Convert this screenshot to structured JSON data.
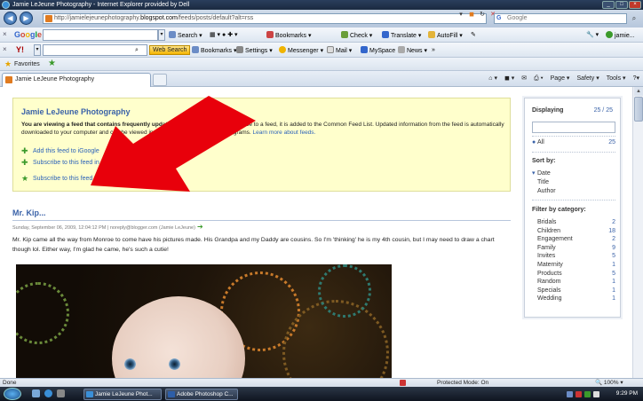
{
  "window": {
    "title": "Jamie LeJeune Photography - Internet Explorer provided by Dell"
  },
  "addressbar": {
    "url_prefix": "http://jamielejeunephotography.",
    "url_domain": "blogspot.com",
    "url_suffix": "/feeds/posts/default?alt=rss",
    "search_placeholder": "Google"
  },
  "google_toolbar": {
    "logo": "Google",
    "search_label": "Search",
    "bookmarks": "Bookmarks",
    "check": "Check",
    "translate": "Translate",
    "autofill": "AutoFill",
    "user": "jamie..."
  },
  "yahoo_toolbar": {
    "logo": "Y!",
    "web_search": "Web Search",
    "bookmarks": "Bookmarks",
    "settings": "Settings",
    "messenger": "Messenger",
    "mail": "Mail",
    "myspace": "MySpace",
    "news": "News"
  },
  "favorites": {
    "label": "Favorites"
  },
  "tab": {
    "title": "Jamie LeJeune Photography"
  },
  "command_bar": {
    "page": "Page",
    "safety": "Safety",
    "tools": "Tools"
  },
  "feed_banner": {
    "title": "Jamie LeJeune Photography",
    "bold_msg": "You are viewing a feed that contains frequently updated content.",
    "msg": " When you subscribe to a feed, it is added to the Common Feed List. Updated information from the feed is automatically downloaded to your computer and can be viewed in Internet Explorer and other programs.",
    "learn_more": "Learn more about feeds.",
    "links": [
      "Add this feed to iGoogle",
      "Subscribe to this feed in Google",
      "Subscribe to this feed"
    ]
  },
  "post": {
    "title": "Mr. Kip...",
    "meta": "Sunday, September 06, 2009, 12:04:12 PM | noreply@blogger.com (Jamie LeJeune)",
    "body": "Mr. Kip came all the way from Monroe to come have his pictures made. His Grandpa and my Daddy are cousins. So I'm 'thinking' he is my 4th cousin, but I may need to draw a chart though lol. Either way, I'm glad he came, he's such a cutie!"
  },
  "sidebar": {
    "displaying_label": "Displaying",
    "displaying_count": "25 / 25",
    "all_label": "All",
    "all_count": "25",
    "sort_label": "Sort by:",
    "sort_options": [
      "Date",
      "Title",
      "Author"
    ],
    "filter_label": "Filter by category:",
    "categories": [
      {
        "name": "Bridals",
        "count": "2"
      },
      {
        "name": "Children",
        "count": "18"
      },
      {
        "name": "Engagement",
        "count": "2"
      },
      {
        "name": "Family",
        "count": "9"
      },
      {
        "name": "Invites",
        "count": "5"
      },
      {
        "name": "Maternity",
        "count": "1"
      },
      {
        "name": "Products",
        "count": "5"
      },
      {
        "name": "Random",
        "count": "1"
      },
      {
        "name": "Specials",
        "count": "1"
      },
      {
        "name": "Wedding",
        "count": "1"
      }
    ]
  },
  "statusbar": {
    "done": "Done",
    "protected_mode": "Protected Mode: On",
    "zoom": "100%"
  },
  "taskbar": {
    "task1": "Jamie LeJeune Phot...",
    "task2": "Adobe Photoshop C...",
    "time": "9:29 PM"
  },
  "colors": {
    "link_blue": "#2b62b9",
    "title_blue": "#3a62a8",
    "banner_bg": "#ffffcc",
    "arrow_red": "#e8000b"
  }
}
